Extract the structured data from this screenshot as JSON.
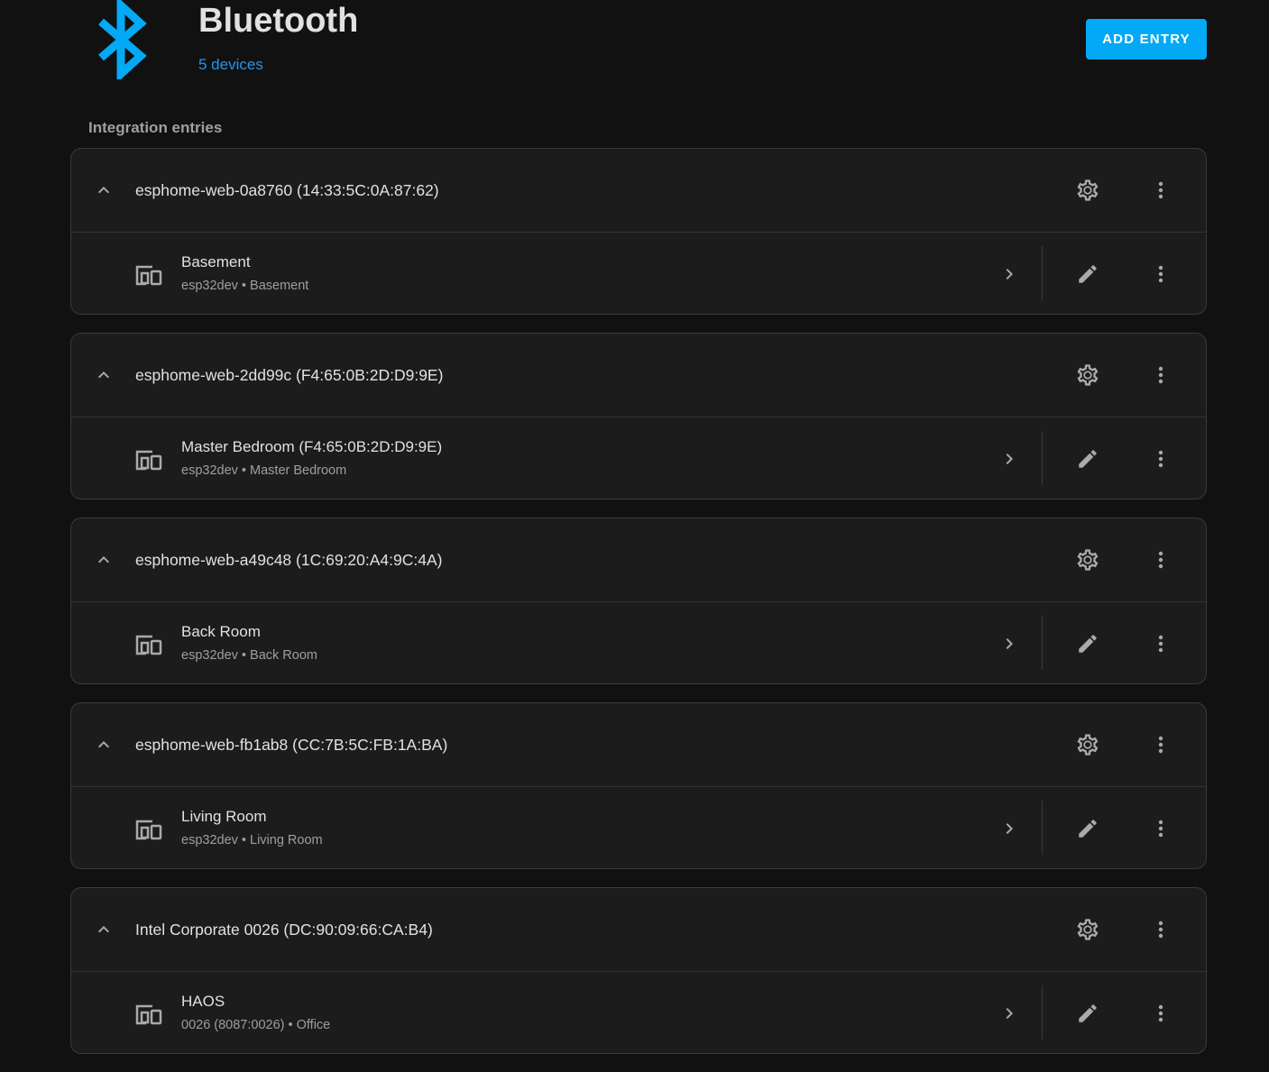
{
  "header": {
    "title": "Bluetooth",
    "devices_link": "5 devices",
    "add_entry_label": "ADD ENTRY"
  },
  "section_label": "Integration entries",
  "colors": {
    "accent": "#03a9f4",
    "link": "#2196f3",
    "bluetooth_logo": "#03a9f4"
  },
  "entries": [
    {
      "title": "esphome-web-0a8760 (14:33:5C:0A:87:62)",
      "device": {
        "name": "Basement",
        "subtitle": "esp32dev • Basement"
      }
    },
    {
      "title": "esphome-web-2dd99c (F4:65:0B:2D:D9:9E)",
      "device": {
        "name": "Master Bedroom (F4:65:0B:2D:D9:9E)",
        "subtitle": "esp32dev • Master Bedroom"
      }
    },
    {
      "title": "esphome-web-a49c48 (1C:69:20:A4:9C:4A)",
      "device": {
        "name": "Back Room",
        "subtitle": "esp32dev • Back Room"
      }
    },
    {
      "title": "esphome-web-fb1ab8 (CC:7B:5C:FB:1A:BA)",
      "device": {
        "name": "Living Room",
        "subtitle": "esp32dev • Living Room"
      }
    },
    {
      "title": "Intel Corporate 0026 (DC:90:09:66:CA:B4)",
      "device": {
        "name": "HAOS",
        "subtitle": "0026 (8087:0026) • Office"
      }
    }
  ],
  "icons": {
    "logo": "bluetooth-icon",
    "collapse": "chevron-up-icon",
    "settings": "gear-icon",
    "menu": "dots-vertical-icon",
    "device": "devices-icon",
    "open": "chevron-right-icon",
    "edit": "pencil-icon"
  }
}
